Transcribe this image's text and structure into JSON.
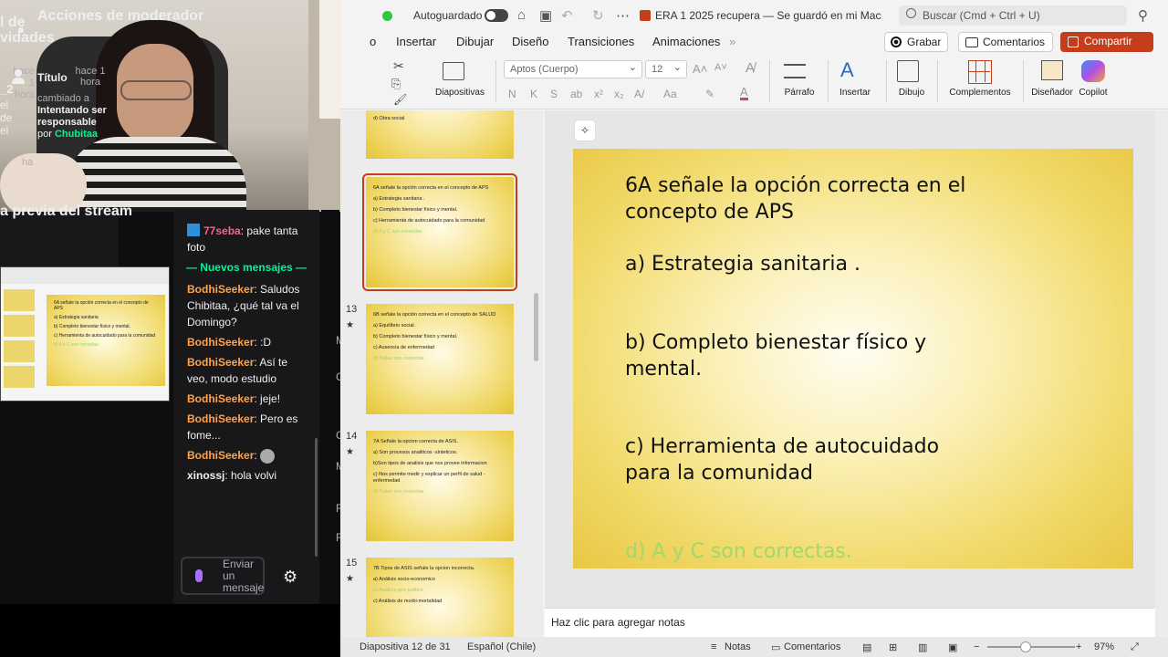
{
  "stream": {
    "preview_title": "a previa del stream",
    "chat": {
      "top_message": {
        "user": "77seba",
        "text": "pake tanta foto",
        "color": "#ff5f8f"
      },
      "new_messages_label": "Nuevos mensajes",
      "messages": [
        {
          "user": "BodhiSeeker",
          "text": "Saludos Chibitaa, ¿qué tal va el Domingo?",
          "color": "#ffa34d"
        },
        {
          "user": "BodhiSeeker",
          "text": ":D",
          "color": "#ffa34d"
        },
        {
          "user": "BodhiSeeker",
          "text": "Así te veo, modo estudio",
          "color": "#ffa34d"
        },
        {
          "user": "BodhiSeeker",
          "text": "jeje!",
          "color": "#ffa34d"
        },
        {
          "user": "BodhiSeeker",
          "text": "Pero es fome...",
          "color": "#ffa34d"
        },
        {
          "user": "BodhiSeeker",
          "text": "",
          "color": "#ffa34d"
        },
        {
          "user": "xinossj",
          "text": "hola volvi",
          "color": "#efeff1"
        }
      ],
      "input_placeholder": "Enviar un mensaje",
      "right_strip": [
        "M",
        "C",
        "C",
        "M",
        "R",
        "F"
      ]
    },
    "activity": {
      "title": "l de\nvidades",
      "ago": "hace 1 hora",
      "count": "_2",
      "lines": "el\nde\nel",
      "bottom": "ha"
    },
    "moderator": {
      "title": "Acciones de moderador",
      "item_title": "Título",
      "ago": "hace 1 hora",
      "changed_to_label": "cambiado a",
      "new_title": "Intentando ser responsable",
      "by_label": "por",
      "channel": "Chubitaa"
    },
    "mini_slide_lines": [
      "6A señale la opción correcta en el concepto de APS",
      "a) Estrategia sanitaria",
      "b) Completo bienestar físico y mental.",
      "c) Herramienta de autocuidado para la comunidad",
      "d) A y C son correctas"
    ]
  },
  "ppt": {
    "autosave_label": "Autoguardado",
    "doc_title": "ERA 1 2025 recupera — Se guardó en mi Mac",
    "search_placeholder": "Buscar (Cmd + Ctrl + U)",
    "menu": [
      "o",
      "Insertar",
      "Dibujar",
      "Diseño",
      "Transiciones",
      "Animaciones"
    ],
    "menu_more": "»",
    "record_label": "Grabar",
    "comments_label": "Comentarios",
    "share_label": "Compartir",
    "ribbon": {
      "slides_label": "Diapositivas",
      "font_name": "Aptos (Cuerpo)",
      "font_size": "12",
      "paragraph_label": "Párrafo",
      "insert_label": "Insertar",
      "draw_label": "Dibujo",
      "addins_label": "Complementos",
      "designer_label": "Diseñador",
      "copilot_label": "Copilot",
      "format_buttons": [
        "N",
        "K",
        "S",
        "ab",
        "x²",
        "x₂",
        "A/",
        "Aa"
      ]
    },
    "slides": [
      {
        "num": "",
        "lines": [
          "d) Obra social"
        ],
        "green": []
      },
      {
        "num": "",
        "selected": true,
        "lines": [
          "6A   señale la opción correcta en el concepto de APS",
          "a) Estrategia sanitaria .",
          "b) Completo bienestar físico y mental.",
          "c) Herramienta de autocuidado para la comunidad"
        ],
        "green": [
          "d)  A y C son  correctas"
        ]
      },
      {
        "num": "13",
        "lines": [
          "6B   señale la opción correcta en el concepto de SALUD",
          "a) Equilibrio social  .",
          "b) Completo bienestar físico y mental.",
          "c) Ausencia de enfermedad"
        ],
        "green": [
          "d)  Todas son correctas"
        ]
      },
      {
        "num": "14",
        "lines": [
          "7A   Señale la opcion correcta de ASIS.",
          "a) Son procesos analiticos -sinteticos.",
          "b)Son  tipos de analisis que nos provee informacion",
          "c) Nos permite medir y explicar un perfil de salud - enfermedad"
        ],
        "green": [
          "d) Todas son correctas"
        ]
      },
      {
        "num": "15",
        "lines": [
          "7B   Tipos de ASIS señale la opcion incorrecta.",
          "a) Análisis socio-economico"
        ],
        "green": [
          "b) Análisis geo-politico"
        ],
        "lines_after": [
          "c) Análisis de morbi-mortalidad"
        ]
      }
    ],
    "main_slide": {
      "title_l1": "6A   señale la opción correcta en el",
      "title_l2": "concepto de APS",
      "a": "a) Estrategia sanitaria .",
      "b_l1": "b) Completo bienestar físico y",
      "b_l2": "mental.",
      "c_l1": "c) Herramienta de autocuidado",
      "c_l2": "para la comunidad",
      "d": "d)  A y C son  correctas."
    },
    "notes_placeholder": "Haz clic para agregar notas",
    "status": {
      "slide_of": "Diapositiva 12 de 31",
      "language": "Español (Chile)",
      "notes": "Notas",
      "comments": "Comentarios",
      "zoom": "97%"
    },
    "accent": "#c43e1c"
  }
}
